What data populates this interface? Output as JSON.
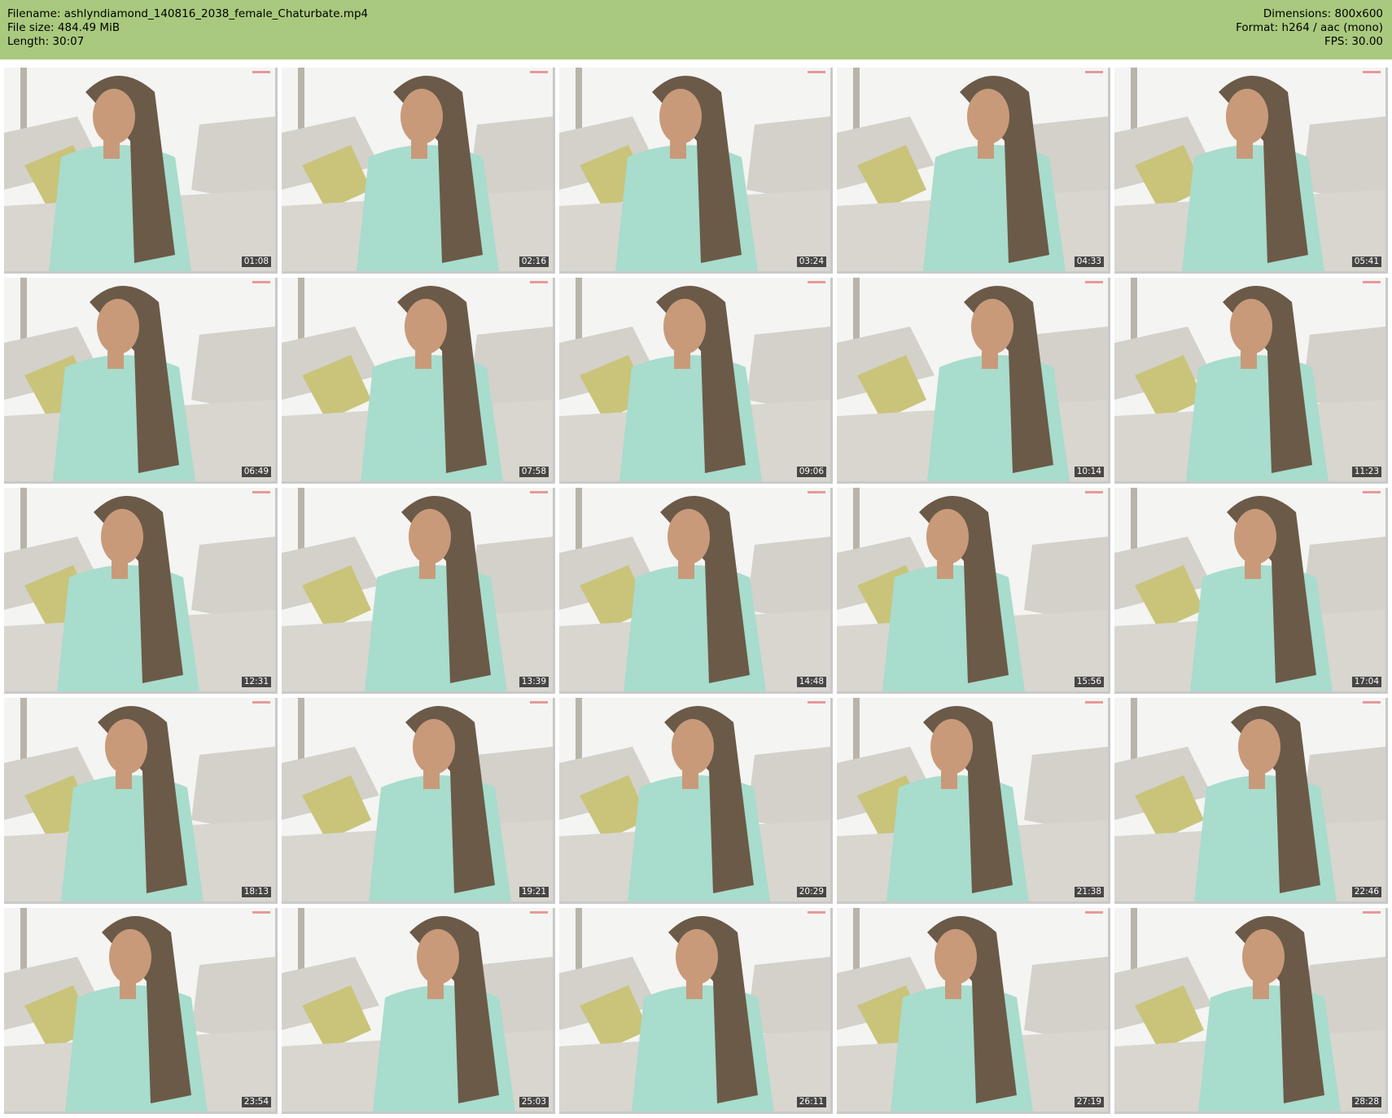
{
  "header": {
    "filename_label": "Filename: ashlyndiamond_140816_2038_female_Chaturbate.mp4",
    "filesize_label": "File size: 484.49 MiB",
    "length_label": "Length: 30:07",
    "dimensions_label": "Dimensions: 800x600",
    "format_label": "Format: h264 / aac (mono)",
    "fps_label": "FPS: 30.00"
  },
  "colors": {
    "header_background": "#a9c97e",
    "sweater": "#a8dccd",
    "couch": "#d8d6cf",
    "pillow": "#c9c47a"
  },
  "thumbnails": [
    {
      "timestamp": "01:08"
    },
    {
      "timestamp": "02:16"
    },
    {
      "timestamp": "03:24"
    },
    {
      "timestamp": "04:33"
    },
    {
      "timestamp": "05:41"
    },
    {
      "timestamp": "06:49"
    },
    {
      "timestamp": "07:58"
    },
    {
      "timestamp": "09:06"
    },
    {
      "timestamp": "10:14"
    },
    {
      "timestamp": "11:23"
    },
    {
      "timestamp": "12:31"
    },
    {
      "timestamp": "13:39"
    },
    {
      "timestamp": "14:48"
    },
    {
      "timestamp": "15:56"
    },
    {
      "timestamp": "17:04"
    },
    {
      "timestamp": "18:13"
    },
    {
      "timestamp": "19:21"
    },
    {
      "timestamp": "20:29"
    },
    {
      "timestamp": "21:38"
    },
    {
      "timestamp": "22:46"
    },
    {
      "timestamp": "23:54"
    },
    {
      "timestamp": "25:03"
    },
    {
      "timestamp": "26:11"
    },
    {
      "timestamp": "27:19"
    },
    {
      "timestamp": "28:28"
    }
  ]
}
